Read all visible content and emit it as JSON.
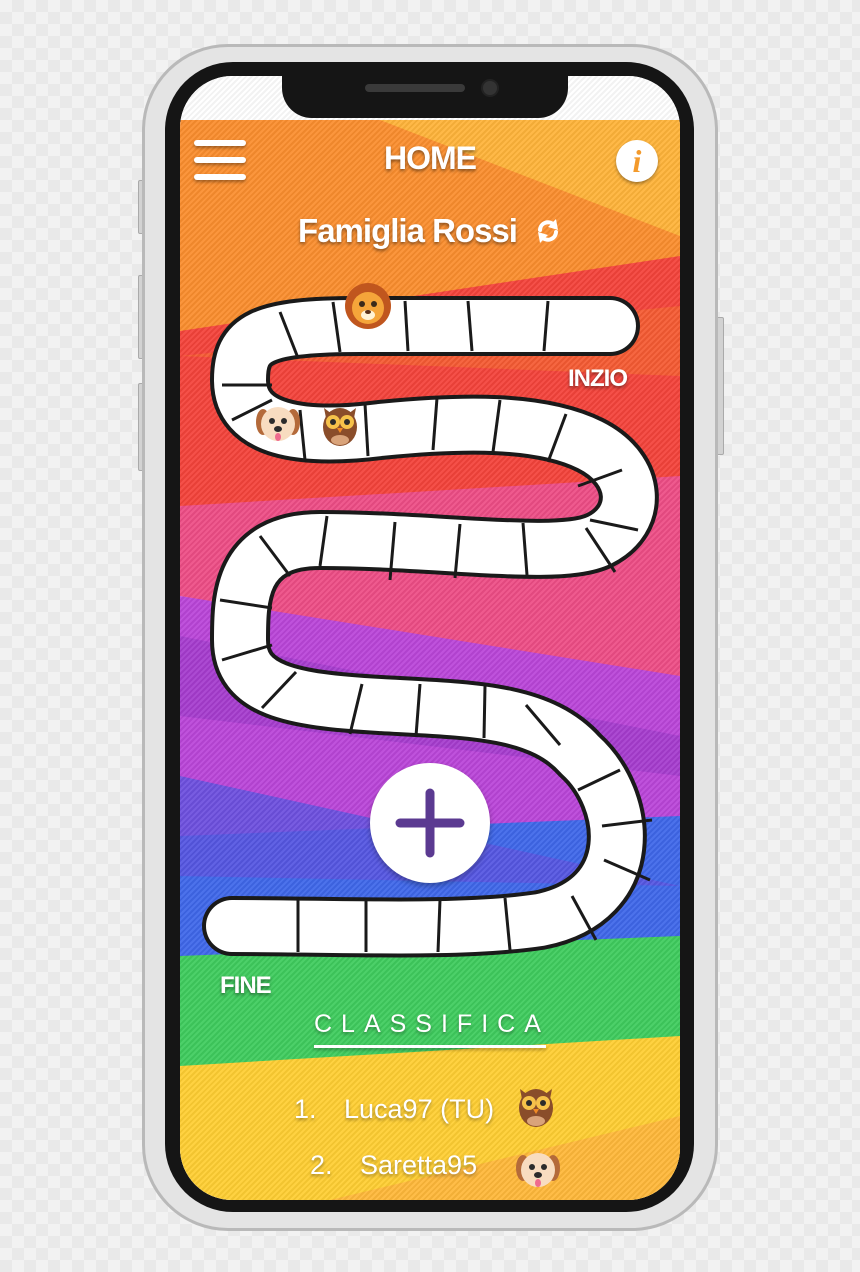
{
  "header": {
    "title": "HOME",
    "menu_icon": "hamburger-menu-icon",
    "info_icon": "info-icon",
    "info_glyph": "i"
  },
  "group": {
    "name": "Famiglia Rossi",
    "switch_icon": "refresh-icon"
  },
  "board": {
    "start_label": "INZIO",
    "end_label": "FINE",
    "players": [
      {
        "animal": "lion"
      },
      {
        "animal": "dog"
      },
      {
        "animal": "owl"
      }
    ]
  },
  "add_button": {
    "icon": "plus-icon"
  },
  "leaderboard": {
    "title": "CLASSIFICA",
    "rows": [
      {
        "rank": "1.",
        "name": "Luca97 (TU)",
        "animal": "owl"
      },
      {
        "rank": "2.",
        "name": "Saretta95",
        "animal": "dog"
      }
    ]
  },
  "colors": {
    "orange": "#fb8e2e",
    "red": "#f4433b",
    "pink": "#ee4d86",
    "purple": "#ba45d9",
    "blue": "#3f67ea",
    "green": "#3fcc5e",
    "yellow": "#ffcf33",
    "accent": "#5b3a91"
  }
}
